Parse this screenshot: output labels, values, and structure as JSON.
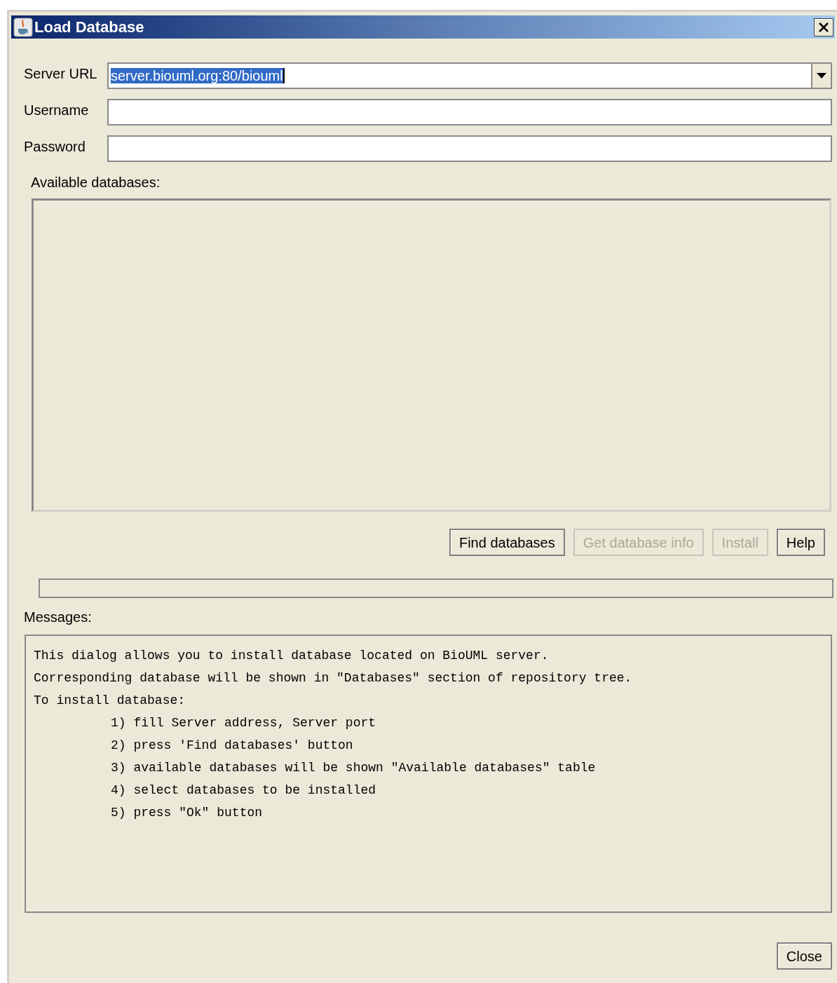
{
  "window": {
    "title": "Load Database"
  },
  "fields": [
    {
      "label": "Server URL",
      "kind": "combo",
      "value": "server.biouml.org:80/biouml",
      "value_selected": true
    },
    {
      "label": "Username",
      "kind": "text"
    },
    {
      "label": "Password",
      "kind": "text"
    }
  ],
  "databases": {
    "label": "Available databases:"
  },
  "buttons": [
    {
      "label": "Find databases",
      "disabled": false
    },
    {
      "label": "Get database info",
      "disabled": true
    },
    {
      "label": "Install",
      "disabled": true
    },
    {
      "label": "Help",
      "disabled": false
    }
  ],
  "messages": {
    "label": "Messages:",
    "lines": [
      {
        "text": "This dialog allows you to install database located on BioUML server.",
        "kind": "text"
      },
      {
        "text": "Corresponding database will be shown in \"Databases\" section of repository tree.",
        "kind": "text"
      },
      {
        "text": "To install database:",
        "kind": "text"
      },
      {
        "text": "1) fill Server address, Server port",
        "kind": "step"
      },
      {
        "text": "2) press 'Find databases' button",
        "kind": "step"
      },
      {
        "text": "3) available databases will be shown \"Available databases\" table",
        "kind": "step"
      },
      {
        "text": "4) select databases to be installed",
        "kind": "step"
      },
      {
        "text": "5) press \"Ok\" button",
        "kind": "step"
      }
    ]
  },
  "footer_buttons": [
    {
      "label": "Close"
    }
  ]
}
